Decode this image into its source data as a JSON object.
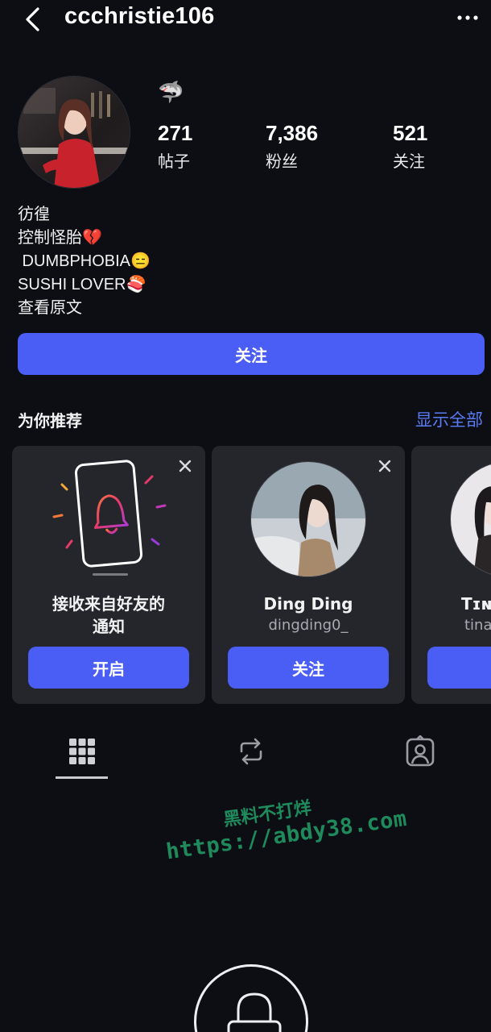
{
  "header": {
    "username": "ccchristie106",
    "back_icon": "chevron-left-icon",
    "more_icon": "more-horizontal-icon"
  },
  "profile": {
    "badge_emoji": "🦈",
    "stats": [
      {
        "value": "271",
        "label": "帖子"
      },
      {
        "value": "7,386",
        "label": "粉丝"
      },
      {
        "value": "521",
        "label": "关注"
      }
    ],
    "bio_lines": [
      "彷徨",
      "控制怪胎💔",
      " DUMBPHOBIA😑",
      "SUSHI LOVER🍣",
      "查看原文"
    ],
    "follow_label": "关注"
  },
  "suggestions": {
    "title": "为你推荐",
    "show_all": "显示全部",
    "cards": [
      {
        "title": "接收来自好友的\n通知",
        "button": "开启"
      },
      {
        "name": "Ding Ding",
        "handle": "dingding0_",
        "button": "关注"
      },
      {
        "name": "Tɪɴ",
        "handle": "tina"
      }
    ]
  },
  "tabs": [
    "grid-icon",
    "reposts-icon",
    "tagged-icon"
  ],
  "watermark": {
    "line1": "黑料不打烊",
    "line2": "https://abdy38.com"
  },
  "colors": {
    "background": "#0c0e13",
    "accent": "#4a5df5",
    "link": "#5b7cf7",
    "card": "#24262c",
    "watermark": "#1f8a5c"
  }
}
